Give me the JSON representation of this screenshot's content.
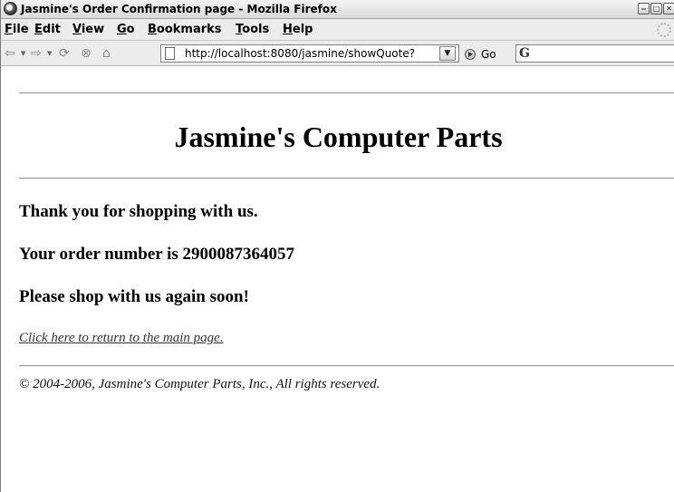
{
  "window": {
    "title": "Jasmine's Order Confirmation page - Mozilla Firefox",
    "buttons": [
      "‒",
      "□",
      "✕"
    ]
  },
  "menubar": {
    "items": [
      "File",
      "Edit",
      "View",
      "Go",
      "Bookmarks",
      "Tools",
      "Help"
    ]
  },
  "navbar": {
    "url": "http://localhost:8080/jasmine/showQuote?",
    "go_label": "Go",
    "search_value": ""
  },
  "page": {
    "heading": "Jasmine's Computer Parts",
    "thanks": "Thank you for shopping with us.",
    "order_text": "Your order number is 2900087364057",
    "again": "Please shop with us again soon!",
    "return_link": "Click here to return to the main page.",
    "copyright": "© 2004-2006, Jasmine's Computer Parts, Inc., All rights reserved."
  },
  "icons": {
    "back": "back-arrow-icon",
    "forward": "forward-arrow-icon",
    "reload": "reload-icon",
    "stop": "stop-icon",
    "home": "home-icon",
    "page": "page-icon",
    "go": "go-icon",
    "search_engine": "google-icon",
    "throbber": "throbber-icon"
  }
}
